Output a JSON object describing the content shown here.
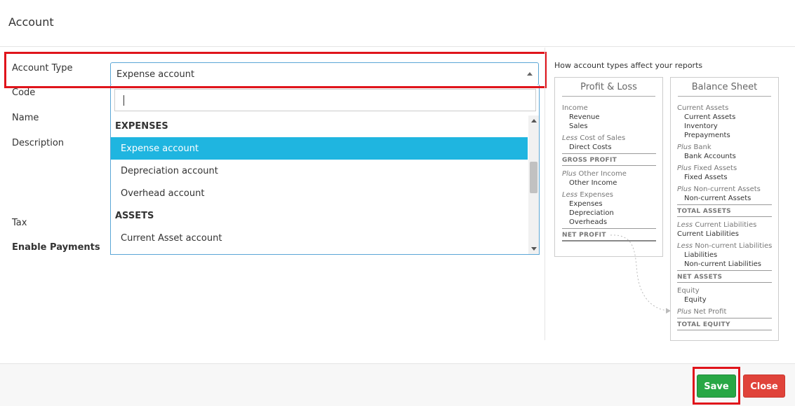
{
  "header": {
    "title": "Account"
  },
  "form": {
    "labels": {
      "account_type": "Account Type",
      "code": "Code",
      "name": "Name",
      "description": "Description",
      "tax": "Tax",
      "enable_payments": "Enable Payments"
    },
    "account_type_select": {
      "value": "Expense account"
    }
  },
  "dropdown": {
    "search_value": "",
    "groups": [
      {
        "label": "EXPENSES",
        "options": [
          "Expense account",
          "Depreciation account",
          "Overhead account"
        ]
      },
      {
        "label": "ASSETS",
        "options": [
          "Current Asset account"
        ]
      }
    ],
    "selected": "Expense account"
  },
  "help": {
    "title": "How account types affect your reports",
    "profit_loss": {
      "title": "Profit & Loss",
      "lines": [
        "Income",
        "Revenue",
        "Sales",
        "Less",
        "Cost of Sales",
        "Direct Costs",
        "GROSS PROFIT",
        "Plus",
        "Other Income",
        "Other Income",
        "Less",
        "Expenses",
        "Expenses",
        "Depreciation",
        "Overheads",
        "NET PROFIT"
      ]
    },
    "balance_sheet": {
      "title": "Balance Sheet",
      "lines": [
        "Current Assets",
        "Current Assets",
        "Inventory",
        "Prepayments",
        "Plus",
        "Bank",
        "Bank Accounts",
        "Plus",
        "Fixed Assets",
        "Fixed Assets",
        "Plus",
        "Non-current Assets",
        "Non-current Assets",
        "TOTAL ASSETS",
        "Less",
        "Current Liabilities",
        "Current Liabilities",
        "Less",
        "Non-current Liabilities",
        "Liabilities",
        "Non-current Liabilities",
        "NET ASSETS",
        "Equity",
        "Equity",
        "Plus",
        "Net Profit",
        "TOTAL EQUITY"
      ]
    }
  },
  "footer": {
    "save_label": "Save",
    "close_label": "Close"
  },
  "colors": {
    "highlight": "#e0141b",
    "selected_option": "#1fb5e0",
    "save": "#28a745",
    "close": "#e0433a"
  }
}
